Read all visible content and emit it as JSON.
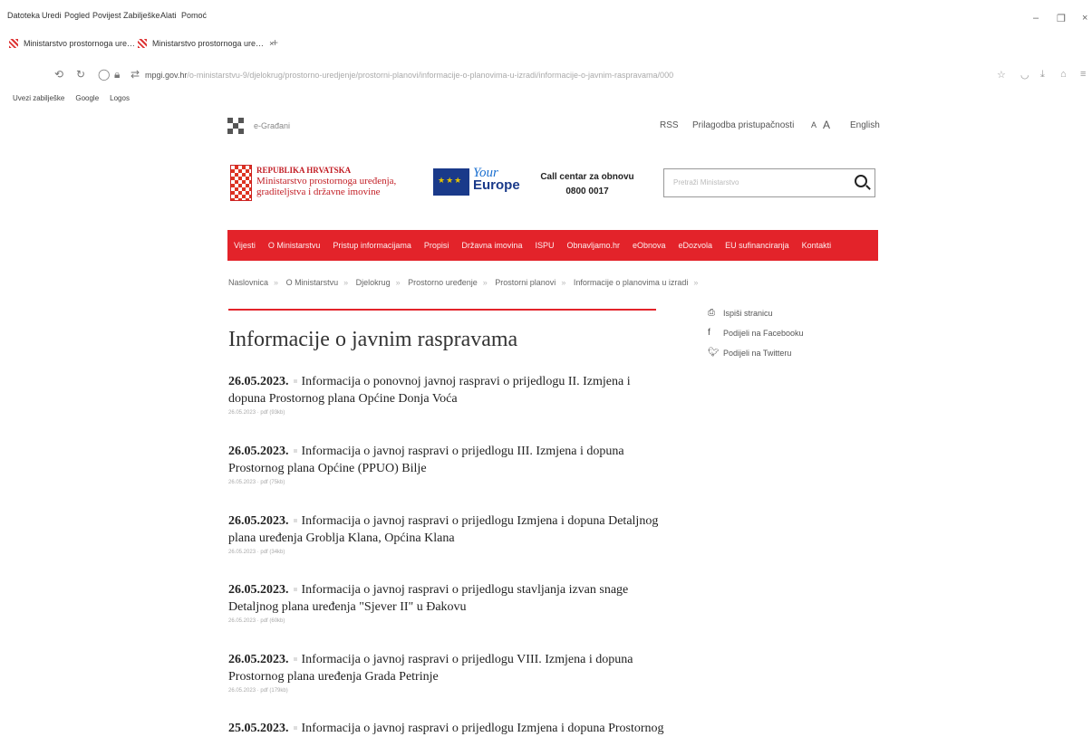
{
  "browser": {
    "menu": [
      "Datoteka",
      "Uredi",
      "Pogled",
      "Povijest",
      "Zabilješke",
      "Alati",
      "Pomoć"
    ],
    "tabs": [
      {
        "title": "Ministarstvo prostornoga ure…"
      },
      {
        "title": "Ministarstvo prostornoga ure…"
      }
    ],
    "url_domain": "mpgi.gov.hr",
    "url_path": "/o-ministarstvu-9/djelokrug/prostorno-uredjenje/prostorni-planovi/informacije-o-planovima-u-izradi/informacije-o-javnim-raspravama/000",
    "bookmarks": [
      "Uvezi zabilješke",
      "Google",
      "Logos"
    ]
  },
  "site": {
    "egradjani": "e-Građani",
    "rss": "RSS",
    "accessibility": "Prilagodba pristupačnosti",
    "font_small": "A",
    "font_large": "A",
    "english": "English",
    "ministry_line1": "REPUBLIKA HRVATSKA",
    "ministry_line2": "Ministarstvo prostornoga uređenja,",
    "ministry_line3": "graditeljstva i državne imovine",
    "your_europe_top": "Your",
    "your_europe_bottom": "Europe",
    "call_center_label": "Call centar za obnovu",
    "call_center_number": "0800 0017",
    "search_placeholder": "Pretraži Ministarstvo",
    "nav": [
      "Vijesti",
      "O Ministarstvu",
      "Pristup informacijama",
      "Propisi",
      "Državna imovina",
      "ISPU",
      "Obnavljamo.hr",
      "eObnova",
      "eDozvola",
      "EU sufinanciranja",
      "Kontakti"
    ],
    "breadcrumbs": [
      "Naslovnica",
      "O Ministarstvu",
      "Djelokrug",
      "Prostorno uređenje",
      "Prostorni planovi",
      "Informacije o planovima u izradi"
    ],
    "page_title": "Informacije o javnim raspravama",
    "share": [
      "Ispiši stranicu",
      "Podijeli na Facebooku",
      "Podijeli na Twitteru"
    ],
    "items": [
      {
        "date": "26.05.2023.",
        "title": "Informacija o ponovnoj javnoj raspravi o prijedlogu II. Izmjena i dopuna Prostornog plana Općine Donja Voća",
        "meta": "26.05.2023 · pdf (93kb)"
      },
      {
        "date": "26.05.2023.",
        "title": "Informacija o javnoj raspravi o prijedlogu III. Izmjena i dopuna Prostornog plana Općine (PPUO) Bilje",
        "meta": "26.05.2023 · pdf (75kb)"
      },
      {
        "date": "26.05.2023.",
        "title": "Informacija o javnoj raspravi o prijedlogu Izmjena i dopuna Detaljnog plana uređenja Groblja Klana, Općina Klana",
        "meta": "26.05.2023 · pdf (34kb)"
      },
      {
        "date": "26.05.2023.",
        "title": "Informacija o javnoj raspravi o prijedlogu stavljanja izvan snage Detaljnog plana uređenja \"Sjever II\" u Đakovu",
        "meta": "26.05.2023 · pdf (60kb)"
      },
      {
        "date": "26.05.2023.",
        "title": "Informacija o javnoj raspravi o prijedlogu VIII. Izmjena i dopuna Prostornog plana uređenja Grada Petrinje",
        "meta": "26.05.2023 · pdf (179kb)"
      },
      {
        "date": "25.05.2023.",
        "title": "Informacija o javnoj raspravi o prijedlogu Izmjena i dopuna Prostornog",
        "meta": ""
      }
    ]
  }
}
